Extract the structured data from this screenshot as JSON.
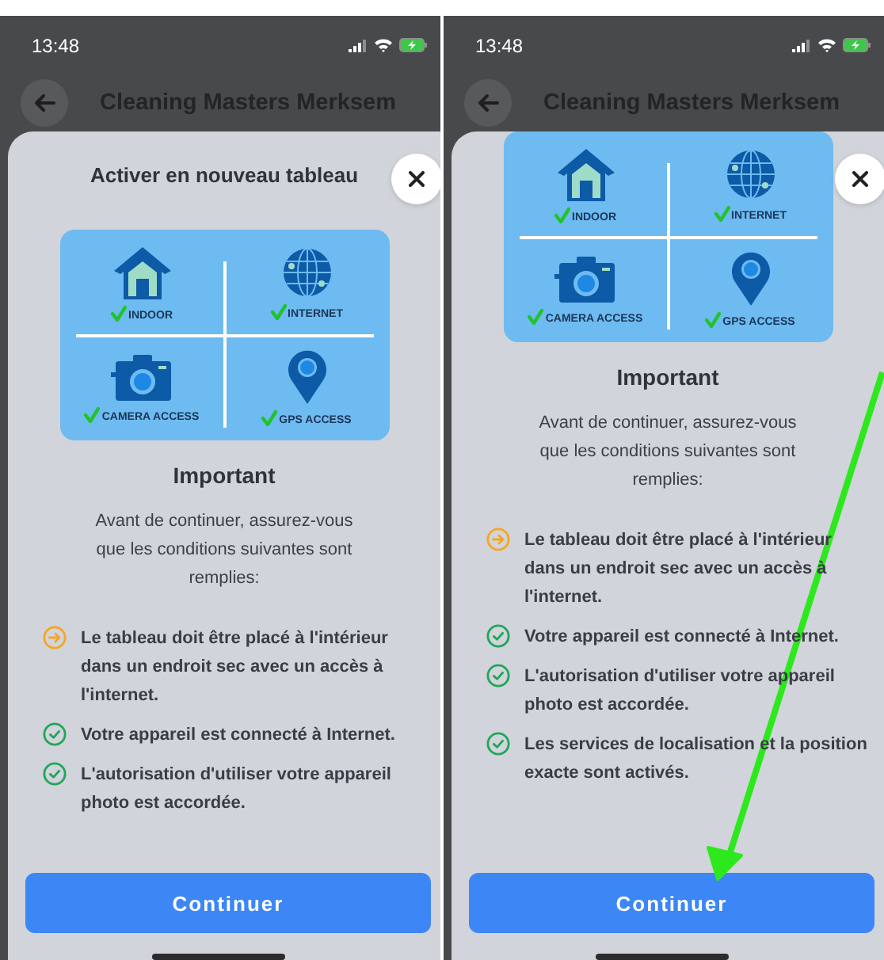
{
  "phones": [
    {
      "status_bar": {
        "time": "13:48"
      },
      "header": {
        "title": "Cleaning Masters Merksem"
      },
      "sheet": {
        "scrolled_to_end": false,
        "title": "Activer en nouveau tableau",
        "illustration": {
          "tiles": [
            {
              "kind": "house",
              "label": "INDOOR"
            },
            {
              "kind": "globe",
              "label": "INTERNET"
            },
            {
              "kind": "camera",
              "label": "CAMERA ACCESS"
            },
            {
              "kind": "pin",
              "label": "GPS ACCESS"
            }
          ]
        },
        "heading": "Important",
        "intro": "Avant de continuer, assurez-vous que les conditions suivantes sont remplies:",
        "conditions": [
          {
            "kind": "pending",
            "text": "Le tableau doit être placé à l'intérieur dans un endroit sec avec un accès à l'internet."
          },
          {
            "kind": "done",
            "text": "Votre appareil est connecté à Internet."
          },
          {
            "kind": "done",
            "text": "L'autorisation d'utiliser votre appareil photo est accordée."
          }
        ],
        "button": "Continuer"
      }
    },
    {
      "status_bar": {
        "time": "13:48"
      },
      "header": {
        "title": "Cleaning Masters Merksem"
      },
      "sheet": {
        "scrolled_to_end": true,
        "illustration": {
          "tiles": [
            {
              "kind": "house",
              "label": "INDOOR"
            },
            {
              "kind": "globe",
              "label": "INTERNET"
            },
            {
              "kind": "camera",
              "label": "CAMERA ACCESS"
            },
            {
              "kind": "pin",
              "label": "GPS ACCESS"
            }
          ]
        },
        "heading": "Important",
        "intro": "Avant de continuer, assurez-vous que les conditions suivantes sont remplies:",
        "conditions": [
          {
            "kind": "pending",
            "text": "Le tableau doit être placé à l'intérieur dans un endroit sec avec un accès à l'internet."
          },
          {
            "kind": "done",
            "text": "Votre appareil est connecté à Internet."
          },
          {
            "kind": "done",
            "text": "L'autorisation d'utiliser votre appareil photo est accordée."
          },
          {
            "kind": "done",
            "text": "Les services de localisation et la position exacte sont activés."
          }
        ],
        "button": "Continuer",
        "annotation": {
          "kind": "arrow"
        }
      }
    }
  ]
}
